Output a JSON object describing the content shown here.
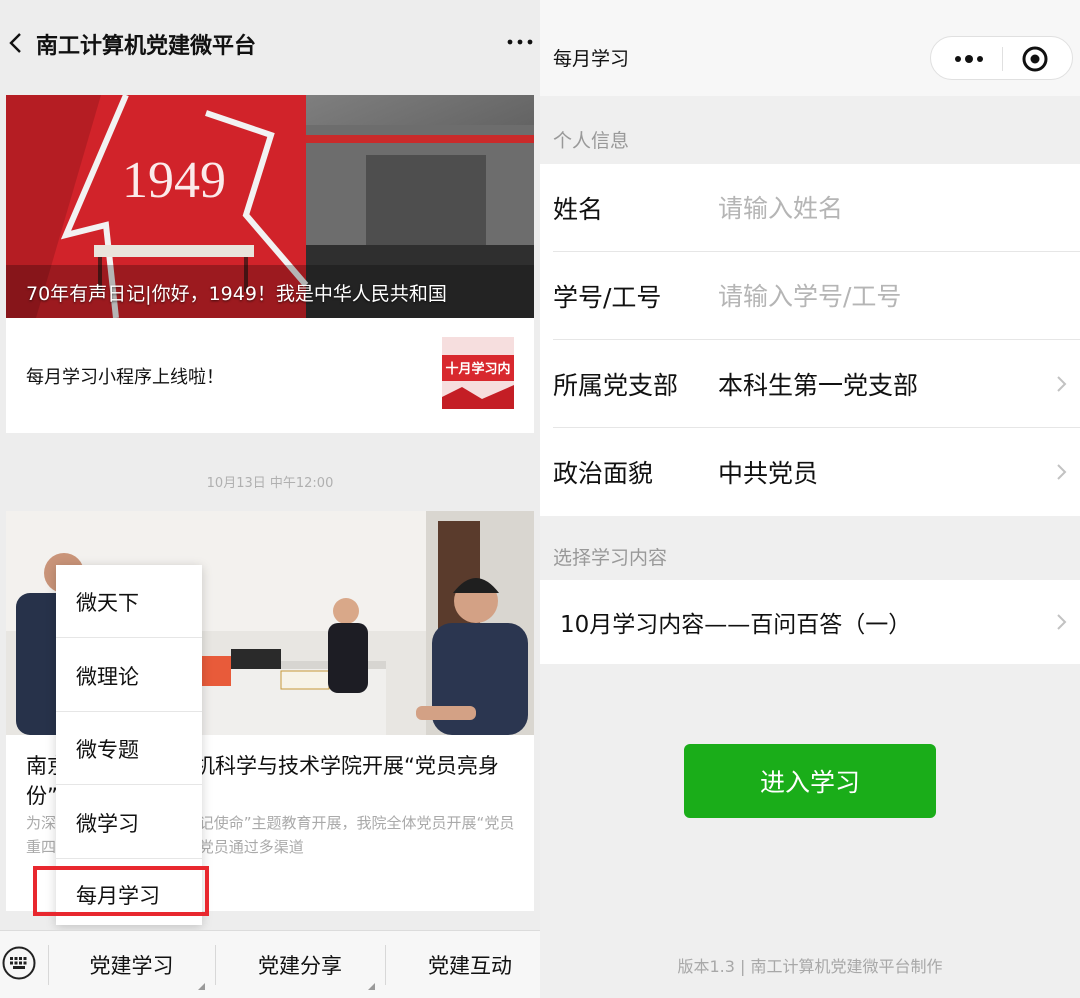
{
  "left": {
    "header": {
      "title": "南工计算机党建微平台"
    },
    "article1": {
      "cover_title": "70年有声日记|你好，1949！我是中华人民共和国",
      "cover_year": "1949",
      "sub_title": "每月学习小程序上线啦！",
      "sub_thumb_text": "十月学习内"
    },
    "timestamp": "10月13日 中午12:00",
    "article2": {
      "title": "南京工业大学计算机科学与技术学院开展“党员亮身份”",
      "digest": "为深入推进“不忘初心、牢记使命”主题教育开展，我院全体党员开展“党员重四亮”活动。近日，全院党员通过多渠道"
    },
    "popup_menu": {
      "items": [
        "微天下",
        "微理论",
        "微专题",
        "微学习",
        "每月学习"
      ],
      "highlighted_index": 4,
      "highlight_color": "#e8272e"
    },
    "bottom_menu": {
      "keyboard_icon": "keyboard-icon",
      "tabs": [
        "党建学习",
        "党建分享",
        "党建互动"
      ]
    }
  },
  "right": {
    "header": {
      "title": "每月学习",
      "more_icon": "more-dots-icon",
      "close_icon": "target-icon"
    },
    "personal_info": {
      "section_label": "个人信息",
      "name_label": "姓名",
      "name_placeholder": "请输入姓名",
      "id_label": "学号/工号",
      "id_placeholder": "请输入学号/工号",
      "branch_label": "所属党支部",
      "branch_value": "本科生第一党支部",
      "politics_label": "政治面貌",
      "politics_value": "中共党员"
    },
    "study_content": {
      "section_label": "选择学习内容",
      "selected": "10月学习内容——百问百答（一）"
    },
    "enter_button": "进入学习",
    "footer": "版本1.3 | 南工计算机党建微平台制作",
    "accent_color": "#1aad19"
  }
}
